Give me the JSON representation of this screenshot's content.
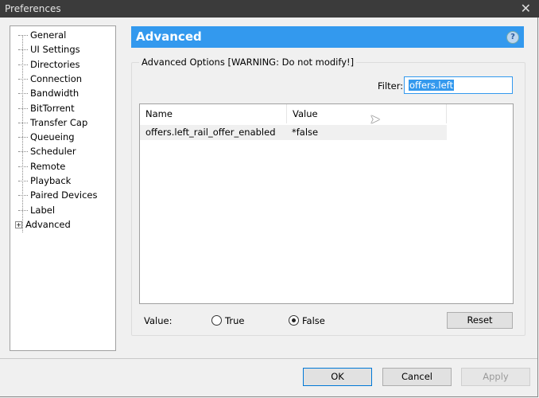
{
  "window": {
    "title": "Preferences"
  },
  "sidebar": {
    "items": [
      "General",
      "UI Settings",
      "Directories",
      "Connection",
      "Bandwidth",
      "BitTorrent",
      "Transfer Cap",
      "Queueing",
      "Scheduler",
      "Remote",
      "Playback",
      "Paired Devices",
      "Label",
      "Advanced"
    ]
  },
  "header": {
    "title": "Advanced",
    "help": "?"
  },
  "group": {
    "label": "Advanced Options [WARNING: Do not modify!]",
    "filter_label": "Filter:",
    "filter_value": "offers.left"
  },
  "table": {
    "columns": [
      "Name",
      "Value"
    ],
    "rows": [
      {
        "name": "offers.left_rail_offer_enabled",
        "value": "*false"
      }
    ]
  },
  "value_editor": {
    "label": "Value:",
    "true_label": "True",
    "false_label": "False",
    "selected": "False",
    "reset": "Reset"
  },
  "buttons": {
    "ok": "OK",
    "cancel": "Cancel",
    "apply": "Apply"
  }
}
